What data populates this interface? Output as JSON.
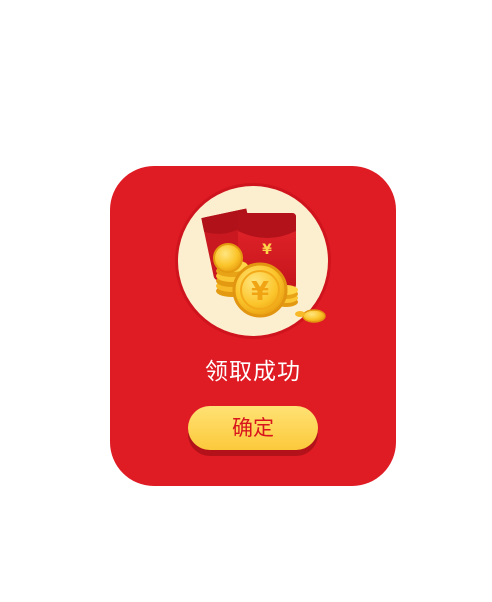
{
  "dialog": {
    "title": "领取成功",
    "confirm_label": "确定"
  },
  "illustration": {
    "icon": "red-envelope-coins-icon",
    "currency_symbol": "¥"
  },
  "colors": {
    "card_bg": "#df1b24",
    "badge_bg": "#fcefcf",
    "button_bg": "#fdd14d",
    "button_text": "#d8151d",
    "title_text": "#ffffff"
  }
}
